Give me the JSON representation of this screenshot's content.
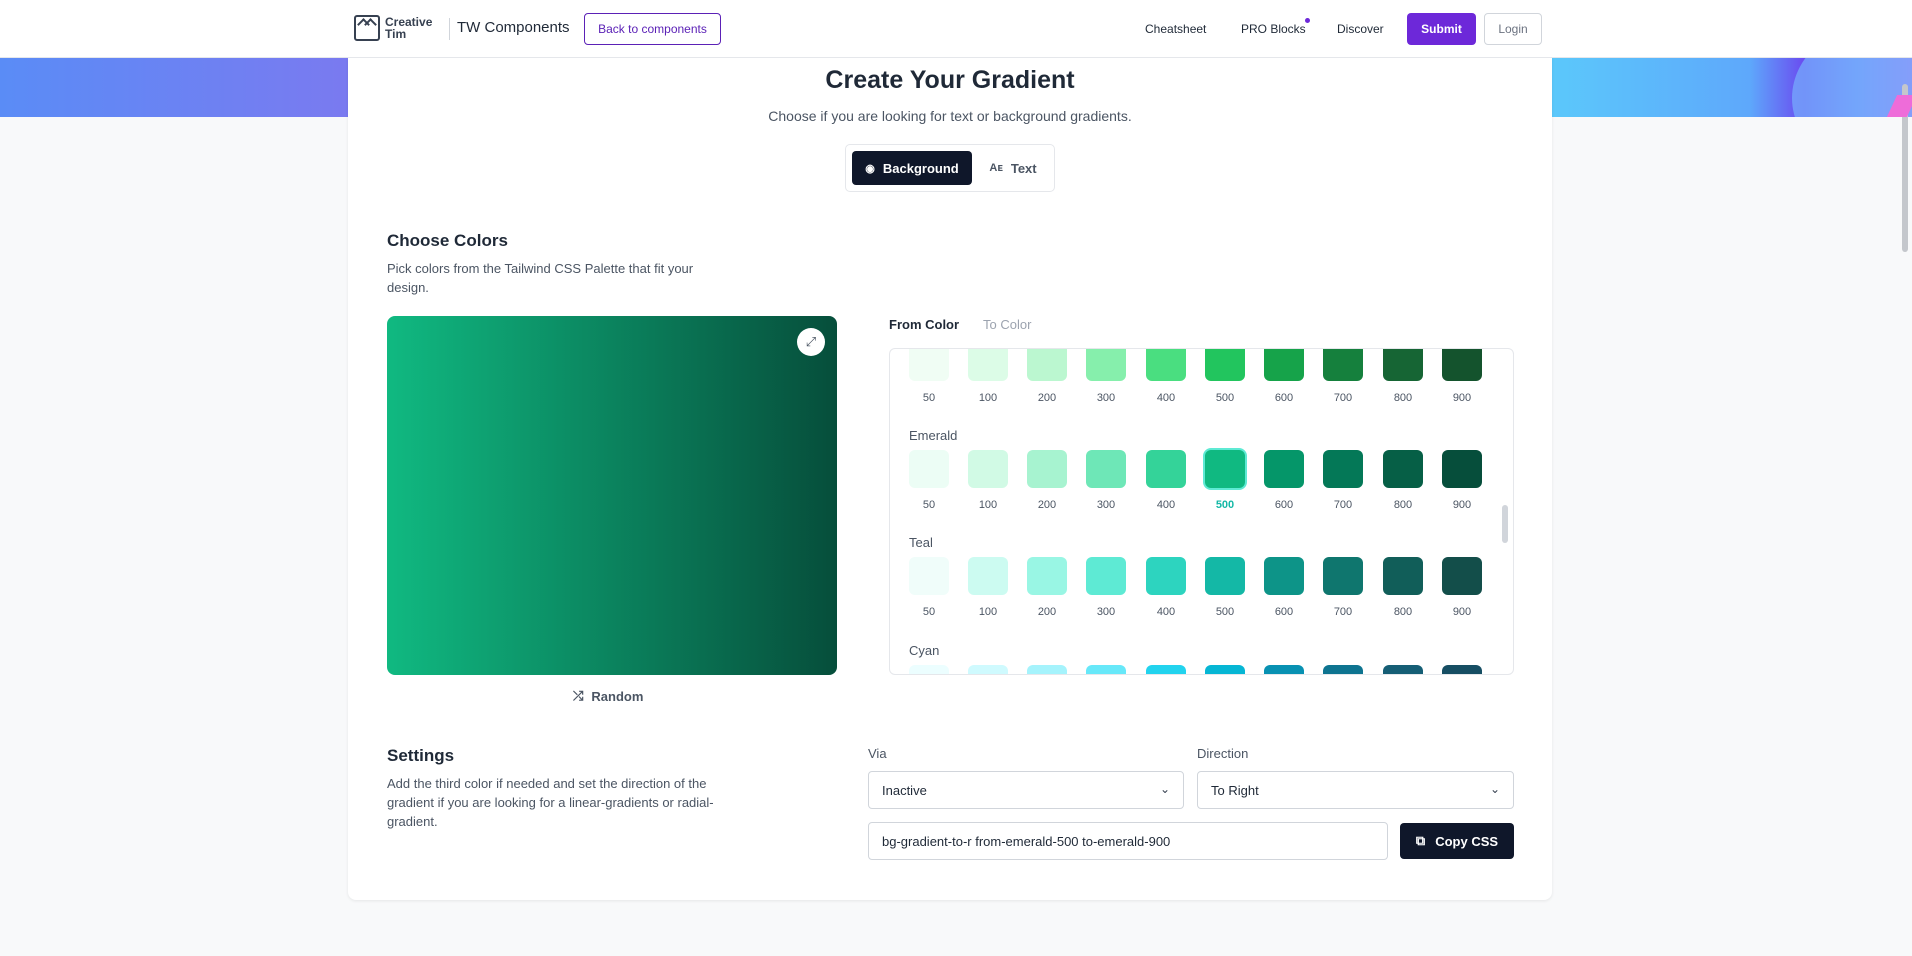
{
  "nav": {
    "logo_text": "Creative Tim",
    "brand_title": "TW Components",
    "back_button": "Back to components",
    "links": [
      "Cheatsheet",
      "PRO Blocks",
      "Discover"
    ],
    "submit_button": "Submit",
    "login_button": "Login"
  },
  "header": {
    "title": "Create Your Gradient",
    "subtitle": "Choose if you are looking for text or background gradients.",
    "modes": [
      {
        "label": "Background",
        "icon": "palette-icon",
        "active": true
      },
      {
        "label": "Text",
        "icon": "font-size-icon",
        "active": false
      }
    ]
  },
  "choose_colors": {
    "title": "Choose Colors",
    "description": "Pick colors from the Tailwind CSS Palette that fit your design.",
    "tabs": [
      "From Color",
      "To Color"
    ],
    "active_tab": "From Color",
    "random_button": "Random",
    "preview_gradient": {
      "from": "#10b981",
      "to": "#064e3b",
      "direction": "to right"
    }
  },
  "palette": {
    "shades": [
      "50",
      "100",
      "200",
      "300",
      "400",
      "500",
      "600",
      "700",
      "800",
      "900"
    ],
    "selected": {
      "group": "Emerald",
      "shade": "500"
    },
    "groups": [
      {
        "name": "",
        "colors": [
          "#f0fdf4",
          "#dcfce7",
          "#bbf7d0",
          "#86efac",
          "#4ade80",
          "#22c55e",
          "#16a34a",
          "#15803d",
          "#166534",
          "#14532d"
        ]
      },
      {
        "name": "Emerald",
        "colors": [
          "#ecfdf5",
          "#d1fae5",
          "#a7f3d0",
          "#6ee7b7",
          "#34d399",
          "#10b981",
          "#059669",
          "#047857",
          "#065f46",
          "#064e3b"
        ]
      },
      {
        "name": "Teal",
        "colors": [
          "#f0fdfa",
          "#ccfbf1",
          "#99f6e4",
          "#5eead4",
          "#2dd4bf",
          "#14b8a6",
          "#0d9488",
          "#0f766e",
          "#115e59",
          "#134e4a"
        ]
      },
      {
        "name": "Cyan",
        "colors": [
          "#ecfeff",
          "#cffafe",
          "#a5f3fc",
          "#67e8f9",
          "#22d3ee",
          "#06b6d4",
          "#0891b2",
          "#0e7490",
          "#155e75",
          "#164e63"
        ]
      }
    ]
  },
  "settings": {
    "title": "Settings",
    "description": "Add the third color if needed and set the direction of the gradient if you are looking for a linear-gradients or radial-gradient.",
    "via_label": "Via",
    "via_value": "Inactive",
    "direction_label": "Direction",
    "direction_value": "To Right",
    "class_output": "bg-gradient-to-r from-emerald-500 to-emerald-900",
    "copy_button": "Copy CSS"
  },
  "colors": {
    "accent": "#6d28d9",
    "dark": "#0f172a",
    "selected_label": "#14b8a6"
  }
}
